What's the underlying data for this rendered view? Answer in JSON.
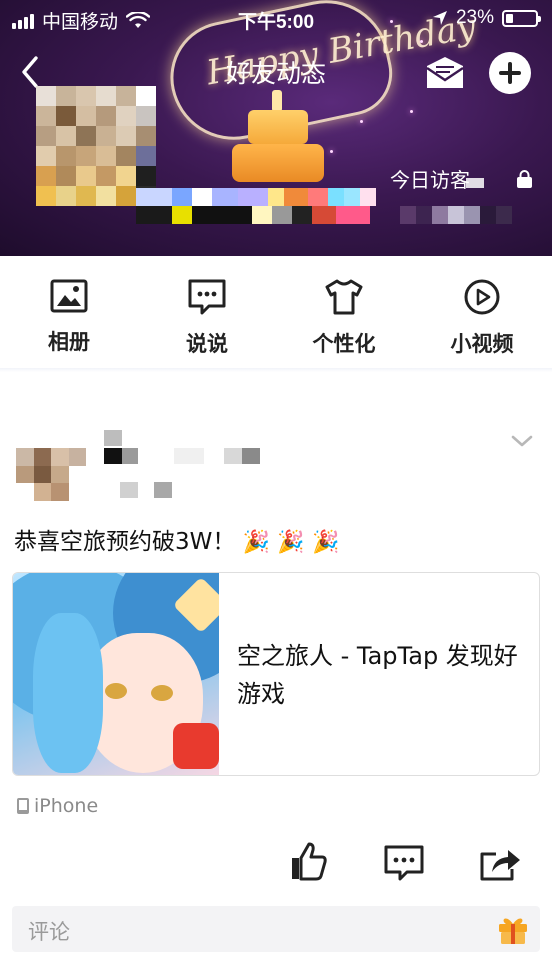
{
  "status_bar": {
    "carrier": "中国移动",
    "time": "下午5:00",
    "battery_percent": "23%",
    "battery_level": 0.23
  },
  "nav": {
    "title": "好友动态",
    "back_icon": "chevron-left-icon",
    "mail_icon": "mail-icon",
    "add_icon": "plus-circle-icon"
  },
  "header": {
    "visitors_label": "今日访客"
  },
  "actions": [
    {
      "label": "相册",
      "icon": "photo-album-icon"
    },
    {
      "label": "说说",
      "icon": "chat-bubble-icon"
    },
    {
      "label": "个性化",
      "icon": "tshirt-icon"
    },
    {
      "label": "小视频",
      "icon": "video-play-icon"
    }
  ],
  "post": {
    "text": "恭喜空旅预约破3W！",
    "emoji": [
      "🎉",
      "🎉",
      "🎉"
    ],
    "link": {
      "title": "空之旅人 - TapTap 发现好游戏"
    },
    "device": "iPhone",
    "comment_placeholder": "评论"
  },
  "colors": {
    "header_bg": "#3a1850",
    "text_primary": "#111111",
    "text_secondary": "#8a8a8a",
    "comment_bg": "#f3f3f5"
  }
}
